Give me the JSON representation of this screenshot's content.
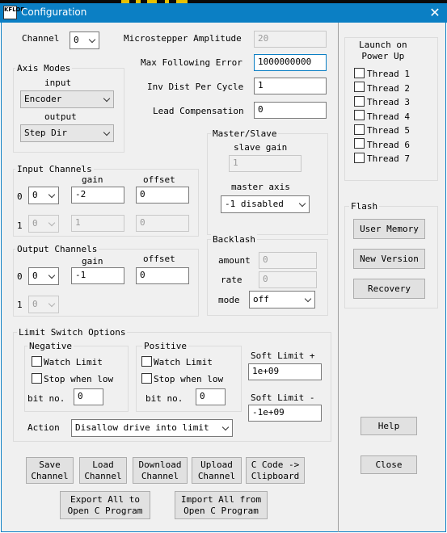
{
  "window": {
    "title": "Configuration",
    "close_glyph": "✕",
    "icon_text": "KFLOP"
  },
  "channel": {
    "label": "Channel",
    "value": "0"
  },
  "microstepper": {
    "label": "Microstepper Amplitude",
    "value": "20"
  },
  "max_following": {
    "label": "Max Following Error",
    "value": "1000000000"
  },
  "inv_dist": {
    "label": "Inv Dist Per Cycle",
    "value": "1"
  },
  "lead_comp": {
    "label": "Lead Compensation",
    "value": "0"
  },
  "axis_modes": {
    "title": "Axis Modes",
    "input_label": "input",
    "input_value": "Encoder",
    "output_label": "output",
    "output_value": "Step Dir"
  },
  "master_slave": {
    "title": "Master/Slave",
    "slave_gain_label": "slave gain",
    "slave_gain_value": "1",
    "master_axis_label": "master axis",
    "master_axis_value": "-1 disabled"
  },
  "input_channels": {
    "title": "Input Channels",
    "gain_header": "gain",
    "offset_header": "offset",
    "rows": [
      {
        "index": "0",
        "channel": "0",
        "gain": "-2",
        "offset": "0"
      },
      {
        "index": "1",
        "channel": "0",
        "gain": "1",
        "offset": "0"
      }
    ]
  },
  "output_channels": {
    "title": "Output Channels",
    "gain_header": "gain",
    "offset_header": "offset",
    "rows": [
      {
        "index": "0",
        "channel": "0",
        "gain": "-1",
        "offset": "0"
      },
      {
        "index": "1",
        "channel": "0"
      }
    ]
  },
  "backlash": {
    "title": "Backlash",
    "amount_label": "amount",
    "amount_value": "0",
    "rate_label": "rate",
    "rate_value": "0",
    "mode_label": "mode",
    "mode_value": "off"
  },
  "limit_switch": {
    "title": "Limit Switch Options",
    "negative": {
      "title": "Negative",
      "watch_label": "Watch Limit",
      "stop_label": "Stop when low",
      "bit_label": "bit no.",
      "bit_value": "0"
    },
    "positive": {
      "title": "Positive",
      "watch_label": "Watch Limit",
      "stop_label": "Stop when low",
      "bit_label": "bit no.",
      "bit_value": "0"
    },
    "soft_limit_pos_label": "Soft Limit +",
    "soft_limit_pos_value": "1e+09",
    "soft_limit_neg_label": "Soft Limit -",
    "soft_limit_neg_value": "-1e+09",
    "action_label": "Action",
    "action_value": "Disallow drive into limit"
  },
  "buttons": {
    "save": "Save\nChannel",
    "load": "Load\nChannel",
    "download": "Download\nChannel",
    "upload": "Upload\nChannel",
    "c_code": "C Code ->\nClipboard",
    "export": "Export All to\nOpen C Program",
    "import": "Import All from\nOpen C Program"
  },
  "launch": {
    "title": "Launch on\nPower Up",
    "threads": [
      "Thread 1",
      "Thread 2",
      "Thread 3",
      "Thread 4",
      "Thread 5",
      "Thread 6",
      "Thread 7"
    ]
  },
  "flash": {
    "title": "Flash",
    "user_memory": "User Memory",
    "new_version": "New Version",
    "recovery": "Recovery"
  },
  "side_buttons": {
    "help": "Help",
    "close": "Close"
  }
}
